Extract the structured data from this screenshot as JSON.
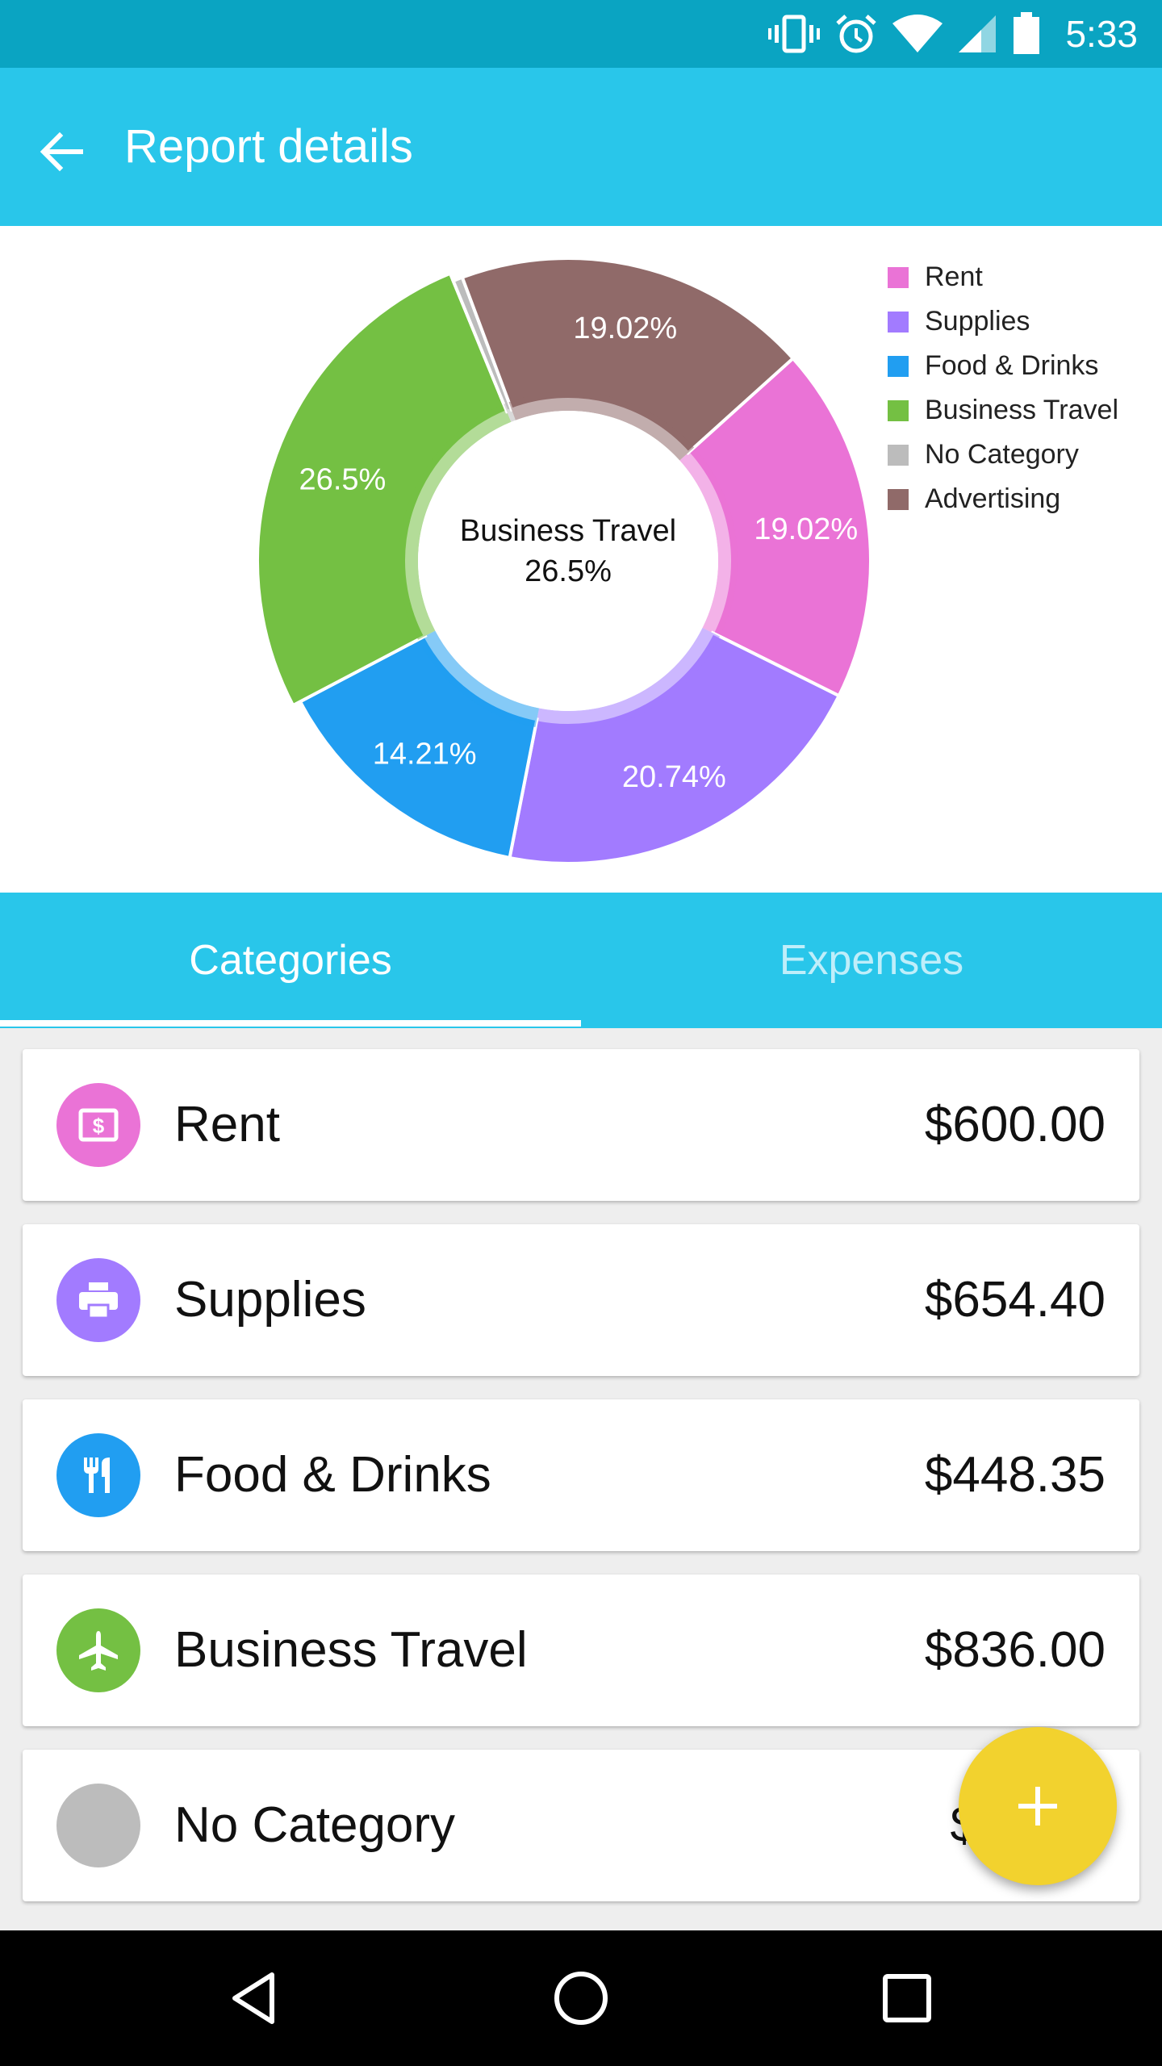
{
  "status_bar": {
    "time": "5:33",
    "icons": [
      "vibrate-icon",
      "alarm-icon",
      "wifi-icon",
      "signal-icon",
      "battery-icon"
    ]
  },
  "app_bar": {
    "title": "Report details",
    "back_icon": "arrow-back-icon"
  },
  "chart_data": {
    "type": "pie",
    "center_label": "Business Travel",
    "center_value": "26.5%",
    "legend_position": "top-right",
    "slices": [
      {
        "name": "Rent",
        "value": 19.02,
        "label": "19.02%",
        "color": "#ea73d6"
      },
      {
        "name": "Supplies",
        "value": 20.74,
        "label": "20.74%",
        "color": "#a27bff"
      },
      {
        "name": "Food & Drinks",
        "value": 14.21,
        "label": "14.21%",
        "color": "#219ef1"
      },
      {
        "name": "Business Travel",
        "value": 26.5,
        "label": "26.5%",
        "color": "#74c043"
      },
      {
        "name": "No Category",
        "value": 0.51,
        "label": "",
        "color": "#bcbcbc"
      },
      {
        "name": "Advertising",
        "value": 19.02,
        "label": "19.02%",
        "color": "#906a69"
      }
    ]
  },
  "legend": [
    {
      "label": "Rent",
      "color": "#ea73d6"
    },
    {
      "label": "Supplies",
      "color": "#a27bff"
    },
    {
      "label": "Food & Drinks",
      "color": "#219ef1"
    },
    {
      "label": "Business Travel",
      "color": "#74c043"
    },
    {
      "label": "No Category",
      "color": "#bcbcbc"
    },
    {
      "label": "Advertising",
      "color": "#906a69"
    }
  ],
  "tabs": [
    {
      "label": "Categories",
      "selected": true
    },
    {
      "label": "Expenses",
      "selected": false
    }
  ],
  "categories": [
    {
      "name": "Rent",
      "amount": "$600.00",
      "icon": "money-icon",
      "color": "#ea73d6"
    },
    {
      "name": "Supplies",
      "amount": "$654.40",
      "icon": "printer-icon",
      "color": "#a27bff"
    },
    {
      "name": "Food & Drinks",
      "amount": "$448.35",
      "icon": "fork-knife-icon",
      "color": "#219ef1"
    },
    {
      "name": "Business Travel",
      "amount": "$836.00",
      "icon": "airplane-icon",
      "color": "#74c043"
    },
    {
      "name": "No Category",
      "amount": "$",
      "icon": "blank-circle-icon",
      "color": "#bcbcbc"
    }
  ],
  "fab": {
    "icon": "plus-icon",
    "color": "#f2d22e"
  },
  "nav_bar": {
    "icons": [
      "back-triangle-icon",
      "home-circle-icon",
      "recents-square-icon"
    ]
  }
}
